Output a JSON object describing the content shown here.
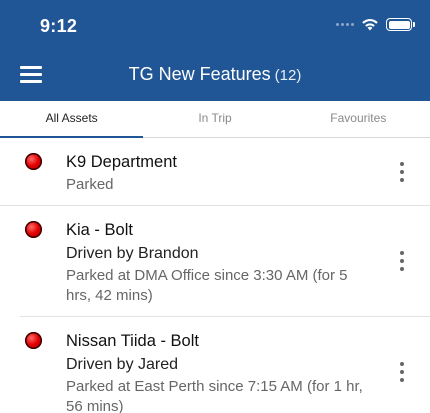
{
  "status_bar": {
    "time": "9:12"
  },
  "header": {
    "title": "TG New Features",
    "count": "(12)"
  },
  "tabs": [
    {
      "label": "All Assets",
      "active": true
    },
    {
      "label": "In Trip",
      "active": false
    },
    {
      "label": "Favourites",
      "active": false
    }
  ],
  "assets": [
    {
      "name": "K9 Department",
      "status": "Parked",
      "status_color": "#e30000"
    },
    {
      "name": "Kia - Bolt",
      "driver": "Driven by Brandon",
      "status": "Parked at DMA Office since 3:30 AM (for 5 hrs, 42 mins)",
      "status_color": "#e30000"
    },
    {
      "name": "Nissan Tiida - Bolt",
      "driver": "Driven by Jared",
      "status": "Parked at East Perth since 7:15 AM (for 1 hr, 56 mins)",
      "status_color": "#e30000"
    }
  ],
  "colors": {
    "header_bg": "#215696",
    "status_red": "#e30000"
  }
}
